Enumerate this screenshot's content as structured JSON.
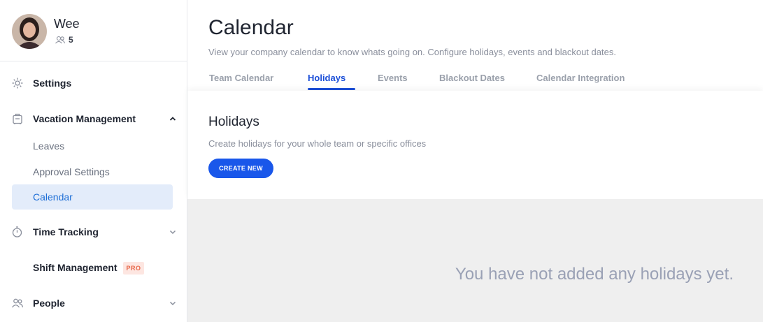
{
  "profile": {
    "name": "Wee",
    "team_count": "5"
  },
  "sidebar": {
    "settings": "Settings",
    "vacation": "Vacation Management",
    "vacation_items": [
      "Leaves",
      "Approval Settings",
      "Calendar"
    ],
    "time_tracking": "Time Tracking",
    "shift": "Shift Management",
    "pro_badge": "PRO",
    "people": "People"
  },
  "header": {
    "title": "Calendar",
    "subtitle": "View your company calendar to know whats going on. Configure holidays, events and blackout dates.",
    "tabs": [
      "Team Calendar",
      "Holidays",
      "Events",
      "Blackout Dates",
      "Calendar Integration"
    ],
    "active_tab": "Holidays"
  },
  "card": {
    "title": "Holidays",
    "subtitle": "Create holidays for your whole team or specific offices",
    "button": "CREATE NEW"
  },
  "empty_state": "You have not added any holidays yet.",
  "colors": {
    "accent": "#1957ea",
    "active_bg": "#e3ecfa",
    "pro": "#e8684a"
  }
}
